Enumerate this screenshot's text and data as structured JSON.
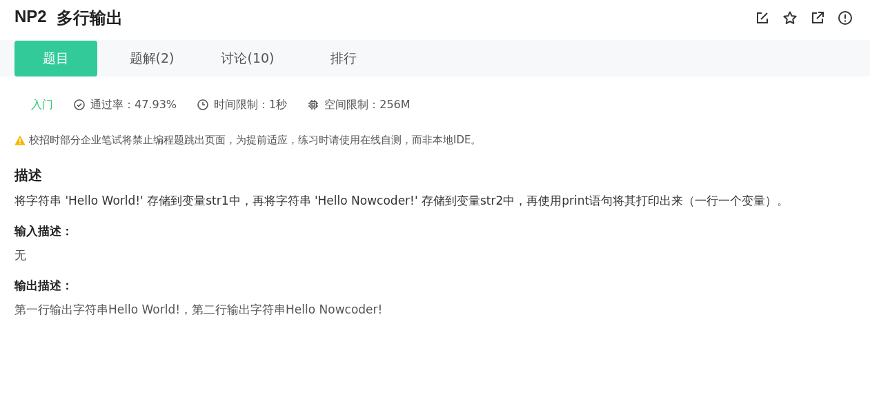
{
  "title": {
    "id": "NP2",
    "name": "多行输出"
  },
  "tabs": [
    {
      "label": "题目",
      "selected": true
    },
    {
      "label": "题解(2)",
      "selected": false
    },
    {
      "label": "讨论(10)",
      "selected": false
    },
    {
      "label": "排行",
      "selected": false
    }
  ],
  "meta": [
    {
      "kind": "difficulty",
      "text": "入门"
    },
    {
      "kind": "pass-rate",
      "text": "通过率：47.93%"
    },
    {
      "kind": "time",
      "text": "时间限制：1秒"
    },
    {
      "kind": "memory",
      "text": "空间限制：256M"
    }
  ],
  "notice": "校招时部分企业笔试将禁止编程题跳出页面，为提前适应，练习时请使用在线自测，而非本地IDE。",
  "description": {
    "heading": "描述",
    "text": "将字符串 'Hello World!' 存储到变量str1中，再将字符串 'Hello Nowcoder!' 存储到变量str2中，再使用print语句将其打印出来（一行一个变量）。"
  },
  "sections": [
    {
      "heading": "输入描述：",
      "text": "无"
    },
    {
      "heading": "输出描述：",
      "text": "第一行输出字符串Hello World!，第二行输出字符串Hello Nowcoder!"
    }
  ]
}
